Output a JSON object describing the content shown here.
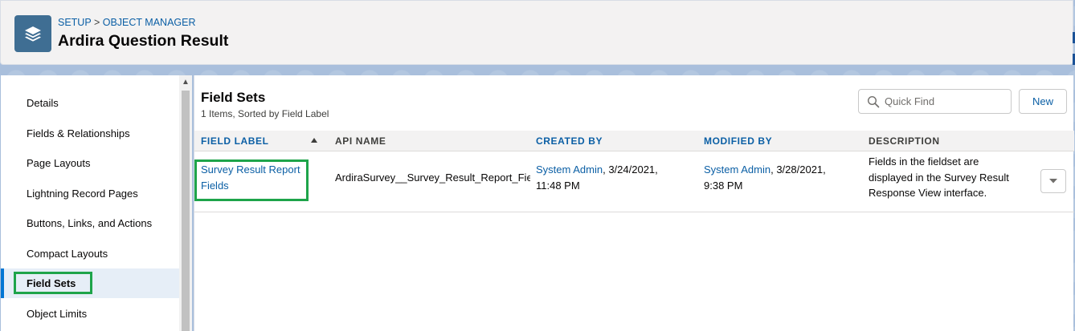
{
  "header": {
    "breadcrumb_setup": "SETUP",
    "breadcrumb_sep": ">",
    "breadcrumb_object_manager": "OBJECT MANAGER",
    "title": "Ardira Question Result",
    "icon": "layers-icon",
    "icon_color": "#3f6e93"
  },
  "sidebar": {
    "items": [
      {
        "label": "Details"
      },
      {
        "label": "Fields & Relationships"
      },
      {
        "label": "Page Layouts"
      },
      {
        "label": "Lightning Record Pages"
      },
      {
        "label": "Buttons, Links, and Actions"
      },
      {
        "label": "Compact Layouts"
      },
      {
        "label": "Field Sets",
        "active": true
      },
      {
        "label": "Object Limits"
      }
    ]
  },
  "main": {
    "title": "Field Sets",
    "subtitle": "1 Items, Sorted by Field Label",
    "search_placeholder": "Quick Find",
    "new_label": "New",
    "columns": {
      "field_label": "Field Label",
      "api_name": "API Name",
      "created_by": "Created By",
      "modified_by": "Modified By",
      "description": "Description"
    },
    "rows": [
      {
        "field_label_line1": "Survey Result Report",
        "field_label_line2": "Fields",
        "api_name": "ArdiraSurvey__Survey_Result_Report_Fie",
        "created_by_user": "System Admin",
        "created_by_date": ", 3/24/2021,",
        "created_by_time": "11:48 PM",
        "modified_by_user": "System Admin",
        "modified_by_date": ", 3/28/2021,",
        "modified_by_time": "9:38 PM",
        "description_line1": "Fields in the fieldset are",
        "description_line2": "displayed in the Survey Result",
        "description_line3": "Response View interface."
      }
    ]
  },
  "colors": {
    "link": "#0b5fa5",
    "highlight": "#1ea44a",
    "active_bar": "#0176d3"
  }
}
